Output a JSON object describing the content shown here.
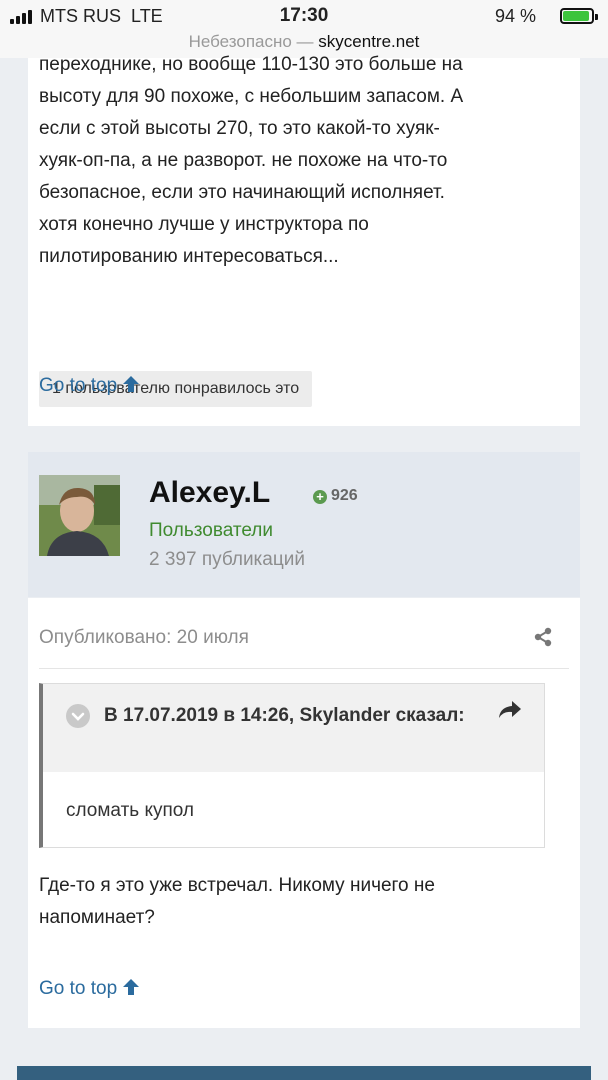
{
  "status_bar": {
    "carrier": "MTS RUS",
    "network": "LTE",
    "time": "17:30",
    "battery_percent": "94 %",
    "battery_level": 0.94
  },
  "url_bar": {
    "security": "Небезопасно —",
    "host": "skycentre.net"
  },
  "prev_post": {
    "lines": [
      "переходнике, но вообще 110-130 это больше на",
      "высоту для 90 похоже, с небольшим запасом. А",
      "если с этой высоты 270, то это какой-то хуяк-",
      "хуяк-оп-па, а не разворот. не похоже на что-то",
      "безопасное, если это начинающий исполняет.",
      "хотя конечно лучше у инструктора по",
      "пилотированию интересоваться..."
    ],
    "likes": "1 пользователю понравилось это",
    "go_to_top": "Go to top"
  },
  "author": {
    "name": "Alexey.L",
    "reputation": "926",
    "group": "Пользователи",
    "post_count": "2 397 публикаций"
  },
  "post": {
    "published": "Опубликовано: 20 июля",
    "quote": {
      "title": "В 17.07.2019 в 14:26, Skylander сказал:",
      "text": "сломать купол"
    },
    "reply_lines": [
      "Где-то я это уже встречал. Никому ничего не",
      "напоминает?"
    ],
    "go_to_top": "Go to top"
  },
  "colors": {
    "link": "#2b6b9e",
    "group": "#3f8a2f",
    "author_bg": "#e3e8ef",
    "page_bg": "#ebeef2"
  }
}
